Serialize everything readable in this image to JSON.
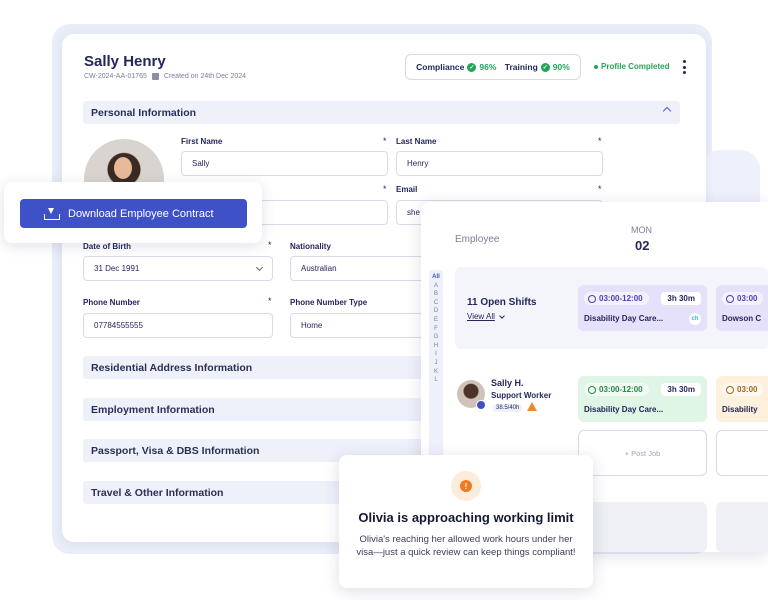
{
  "profile": {
    "name": "Sally Henry",
    "employee_id": "CW-2024-AA-01765",
    "created": "Created on 24th Dec 2024",
    "compliance_label": "Compliance",
    "compliance_value": "96%",
    "training_label": "Training",
    "training_value": "90%",
    "status": "Profile Completed"
  },
  "personal": {
    "section_title": "Personal Information",
    "first_name_label": "First Name",
    "first_name": "Sally",
    "last_name_label": "Last Name",
    "last_name": "Henry",
    "email_label": "Email",
    "email_value": "she",
    "dob_label": "Date of Birth",
    "dob": "31 Dec 1991",
    "nationality_label": "Nationality",
    "nationality": "Australian",
    "phone_label": "Phone Number",
    "phone": "07784555555",
    "phone_type_label": "Phone Number Type",
    "phone_type": "Home",
    "required_mark": "*"
  },
  "sections": [
    "Residential Address Information",
    "Employment Information",
    "Passport, Visa & DBS Information",
    "Travel & Other Information"
  ],
  "download": {
    "label": "Download Employee Contract"
  },
  "schedule": {
    "employee_header": "Employee",
    "day": "MON",
    "date": "02",
    "alphabet": [
      "All",
      "A",
      "B",
      "C",
      "D",
      "E",
      "F",
      "G",
      "H",
      "I",
      "J",
      "K",
      "L"
    ],
    "open_shifts": {
      "title": "11 Open Shifts",
      "link": "View All"
    },
    "open_shift_cards": [
      {
        "time": "03:00-12:00",
        "duration": "3h 30m",
        "name": "Disability Day Care..."
      },
      {
        "time": "03:00",
        "name": "Dowson C"
      }
    ],
    "employee": {
      "name": "Sally H.",
      "role": "Support Worker",
      "hours": "38.5/40h"
    },
    "employee_shifts": [
      {
        "time": "03:00-12:00",
        "duration": "3h 30m",
        "name": "Disability Day Care..."
      },
      {
        "time": "03:00",
        "name": "Disability"
      }
    ],
    "post_job": "+ Post Job",
    "brand_mark": "ch"
  },
  "alert": {
    "icon": "!",
    "title": "Olivia is approaching working limit",
    "body": "Olivia's reaching her allowed work hours under her visa—just a quick review can keep things compliant!"
  }
}
